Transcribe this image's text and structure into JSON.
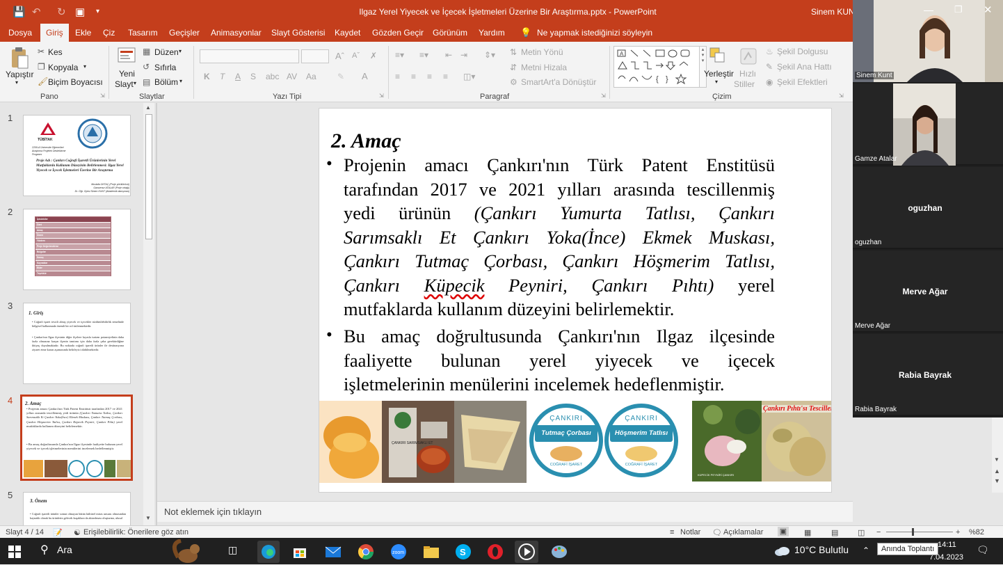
{
  "titlebar": {
    "document_title": "Ilgaz Yerel Yiyecek ve İçecek İşletmeleri Üzerine Bir Araştırma.pptx  -  PowerPoint",
    "user": "Sinem KUNT"
  },
  "tabs": [
    "Dosya",
    "Giriş",
    "Ekle",
    "Çiz",
    "Tasarım",
    "Geçişler",
    "Animasyonlar",
    "Slayt Gösterisi",
    "Kaydet",
    "Gözden Geçir",
    "Görünüm",
    "Yardım"
  ],
  "tell_me": "Ne yapmak istediğinizi söyleyin",
  "ribbon": {
    "clipboard": {
      "paste": "Yapıştır",
      "cut": "Kes",
      "copy": "Kopyala",
      "format_painter": "Biçim Boyacısı",
      "group": "Pano"
    },
    "slides": {
      "new_slide_1": "Yeni",
      "new_slide_2": "Slayt",
      "layout": "Düzen",
      "reset": "Sıfırla",
      "section": "Bölüm",
      "group": "Slaytlar"
    },
    "font": {
      "bold": "K",
      "italic": "T",
      "underline": "A",
      "strike": "S",
      "spacing": "AV",
      "case": "Aa",
      "color": "A",
      "group": "Yazı Tipi"
    },
    "paragraph": {
      "text_direction": "Metin Yönü",
      "align_text": "Metni Hizala",
      "smartart": "SmartArt'a Dönüştür",
      "group": "Paragraf"
    },
    "drawing": {
      "arrange": "Yerleştir",
      "quick_styles_1": "Hızlı",
      "quick_styles_2": "Stiller",
      "shape_fill": "Şekil Dolgusu",
      "shape_outline": "Şekil Ana Hattı",
      "shape_effects": "Şekil Efektleri",
      "group": "Çizim"
    }
  },
  "thumbnails": {
    "numbers": [
      "1",
      "2",
      "3",
      "4",
      "5"
    ],
    "slide1": {
      "org": "TÜBİTAK",
      "line1": "2209-A Üniversite Öğrencileri",
      "line2": "Araştırma Projeleri Destekleme",
      "line3": "Programı",
      "project": "Proje Adı : Çankırı Coğrafi İşaretli Ürünlerinin Yerel Mutfaklarda Kullanım Düzeyinin Belirlenmesi: Ilgaz Yerel Yiyecek ve İçecek İşletmeleri Üzerine Bir Araştırma",
      "author1": "Mustafa OKTAÇ (Proje yürütücüsü)",
      "author2": "Gamzenur ATALAR (Proje ortağı)",
      "author3": "Dr. Öğr. Üyesi Sinem KUNT (Akademik danışman)"
    },
    "slide2": [
      "İçindekiler",
      "Özet",
      "Amaç",
      "Önem",
      "Yöntem",
      "Proje Değerlendirme",
      "Bulgular",
      "Sonuç",
      "Kaynaklar",
      "Ekler",
      "Teşekkür"
    ],
    "slide3": {
      "title": "1. Giriş",
      "b1": "Coğrafi işaret tescili almış yiyecek ve içecekler sürdürülebilirlik temelinde bölgesel kalkınmada önemli bir rol üstlenmektedir.",
      "b2": "Çankırı'nın Ilgaz ilçesinin diğer ilçelere kıyasla turizm potansiyelinin daha fazla olmasına karşın ilçenin tanıtımı için daha fazla çaba gerektirdiğine ihtiyaç duyulmaktadır. Bu noktada coğrafi işaretli ürünler ile destinasyona ziyaret etme kararı aşamasında belirleyici olabilmektedir."
    },
    "slide4": {
      "title": "2. Amaç"
    },
    "slide5": {
      "title": "3. Önem",
      "b1": "Coğrafi işaretli ürünler somut olmayan bütün kültürel miras unsuru olmasından kaynaklı olarak bu ürünlerin gelecek kuşaklara da aktarılması oluşturma, ulusal"
    }
  },
  "slide": {
    "title": "2. Amaç",
    "bullet1": {
      "l1": "Projenin amacı Çankırı'nın Türk Patent Enstitüsü",
      "l2": "tarafından 2017 ve 2021 yılları arasında tescillenmiş",
      "l3a": "yedi ürünün",
      "l3b": "(Çankırı Yumurta Tatlısı, Çankırı",
      "l4": "Sarımsaklı Et Çankırı Yoka(İnce) Ekmek Muskası,",
      "l5": "Çankırı Tutmaç Çorbası, Çankırı Höşmerim Tatlısı,",
      "l6a": "Çankırı",
      "l6b": "Küpecik",
      "l6c": "Peyniri, Çankırı Pıhtı)",
      "l6d": "yerel",
      "l7": "mutfaklarda kullanım düzeyini belirlemektir."
    },
    "bullet2": {
      "l1": "Bu amaç doğrultusunda Çankırı'nın Ilgaz ilçesinde",
      "l2": "faaliyette bulunan yerel yiyecek ve içecek",
      "l3": "işletmelerinin menülerini incelemek hedeflenmiştir."
    },
    "badge1": {
      "top": "ÇANKIRI",
      "mid": "Tutmaç Çorbası",
      "bottom": "COĞRAFİ İŞARET"
    },
    "badge2": {
      "top": "ÇANKIRI",
      "mid": "Höşmerim Tatlısı",
      "bottom": "COĞRAFİ İŞARET"
    },
    "photo_caption": "Çankırı Pıhtı'sı Tescillendi",
    "photo_label": "ÇANKIRI SARIMSAKLI ET",
    "photo_label2": "KÜPECİK PEYNİRİ ÇANKIRI"
  },
  "notes_placeholder": "Not eklemek için tıklayın",
  "status": {
    "slide": "Slayt 4 / 14",
    "accessibility": "Erişilebilirlik: Önerilere göz atın",
    "notes": "Notlar",
    "comments": "Açıklamalar",
    "zoom": "%82"
  },
  "participants": [
    "Sinem Kunt",
    "Gamze Atalar",
    "oguzhan",
    "Merve Ağar",
    "Rabia Bayrak"
  ],
  "participant_center": [
    "oguzhan",
    "Merve Ağar",
    "Rabia Bayrak"
  ],
  "taskbar": {
    "search": "Ara",
    "weather": "10°C  Bulutlu",
    "time": "14:11",
    "date": "7.04.2023",
    "tooltip": "Anında Toplantı"
  },
  "colors": {
    "accent": "#c43e1c",
    "ribbon_bg": "#f3f3f3",
    "taskbar": "#202020",
    "badge_teal": "#2a8fb0"
  }
}
